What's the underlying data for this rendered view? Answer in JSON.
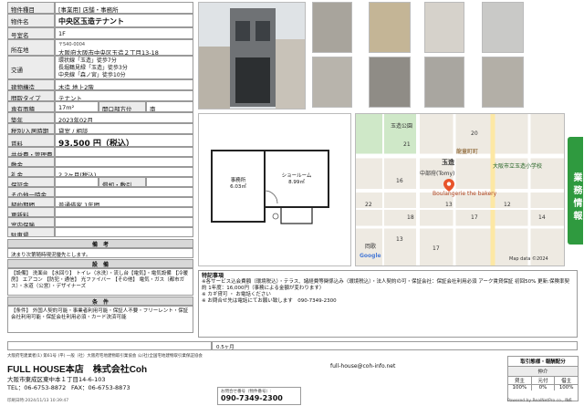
{
  "table": {
    "type_label": "物件種目",
    "type_value": "[事業用] 店舗・事務所",
    "name_label": "物件名",
    "name_value": "中央区玉造テナント",
    "room_label": "号室名",
    "room_value": "1F",
    "address_label": "所在地",
    "zip": "〒540-0004",
    "address": "大阪府大阪市中央区玉造２丁目13-18",
    "access_label": "交通",
    "access_lines": [
      "環状線「玉造」徒歩7分",
      "長堀鶴見緑「玉造」徒歩3分",
      "中央線「森ノ宮」徒歩10分"
    ],
    "structure_label": "建物構造",
    "structure_value": "木造 地上2階",
    "layout_label": "間取タイプ",
    "layout_value": "テナント",
    "area_label": "専有面積",
    "area_value": "17m²",
    "opening_label": "開口部方位",
    "opening_value": "南",
    "built_label": "築年",
    "built_value": "2023年02月",
    "tax_label": "税別/入居時期",
    "tax_value": "貸室 / 相談",
    "rent_label": "賃料",
    "rent_value": "93,500 円（税込）",
    "fee_label": "共益費・管理費",
    "deposit_label": "敷金",
    "reikin_label": "礼金",
    "reikin_value": "2.2ヶ月(税込)",
    "hosho_label": "保証金",
    "shokyaku_label": "償却・敷引",
    "other_label": "その他一時金",
    "contract_label": "契約期間",
    "contract_value": "普通借家 1年間",
    "renewal_label": "更新料",
    "insurance_label": "室内保険",
    "parking_label": "駐車場"
  },
  "biko": {
    "header": "備　考",
    "text": "決まり次第随時現況優先とします。"
  },
  "setsubi": {
    "header": "設　備",
    "text": "【設備】 洗面台 【水回り】 トイレ（水洗）・流し台【電気】・電気設備 【冷暖房】 エアコン 【防犯・通信】 光ファイバー 【その他】 電気・ガス（都市ガス）・水道（公営）・デザイナーズ"
  },
  "jouken": {
    "header": "条　件",
    "text": "【条件】 外国人契約可能・事業者利用可能・保証人不要・フリーレント・保証会社利用可能・保証会社利用必須・カード決済可能"
  },
  "floorplan": {
    "room1_label": "事務所",
    "room1_size": "6.03㎡",
    "room2_label": "ショールーム",
    "room2_size": "8.99㎡"
  },
  "map": {
    "station": "玉造",
    "pin_label": "Boulangerie the bakery",
    "labels": [
      "玉造公園",
      "龍童町町",
      "大阪市立玉造小学校",
      "中部府(Tomy)",
      "岡歌",
      "玉造",
      "Google",
      "Map data ©2024"
    ],
    "blocks": [
      "21",
      "20",
      "16",
      "17",
      "22",
      "18",
      "14",
      "13",
      "12",
      "13",
      "17"
    ]
  },
  "notes": {
    "title": "特記事項",
    "line1": "※各サービス込会費額（環境税込）・テラス、諸経費等関係込み（環境税込）・法人契約の可・保証会社：保証会社利用必須 アーク賃貸保証 初回50% 更新:保険率契約 1年度：16,000円（事務による金額が変わります）",
    "line2": "※ カギ貸可 ・ お電話ください",
    "line3": "※ お問合せ先は電話にてお願い致します　090-7349-2300"
  },
  "bottom_row": {
    "label": "0.5ヶ月"
  },
  "footer": {
    "disclaimer": "大阪府宅建業者(1) 第61号 (平) 一般（社）大阪府宅地建物取引業協会 公(社)全国宅地建物取引業保証協会",
    "company": "FULL HOUSE本店　株式会社Coh",
    "address": "大阪市東成区東中本１丁目14-6-103",
    "tel": "TEL：06-6753-8872",
    "fax": "FAX：06-6753-8873",
    "email": "full-house@coh-info.net",
    "print_note": "印刷日時:2024/11/13 10:39:47",
    "phone_small": "お問合せ番号（物件番号）:",
    "phone": "090-7349-2300",
    "deal_title": "取引態様・報酬配分",
    "deal_sub": "仲介",
    "deal_rows": [
      [
        "貸主",
        "元付",
        "借主"
      ],
      [
        "100%",
        "0%",
        "100%"
      ]
    ],
    "powered": "Powered by RealNetPro co., ltd."
  },
  "side_tab": "業務情報",
  "page_num": "1/1"
}
